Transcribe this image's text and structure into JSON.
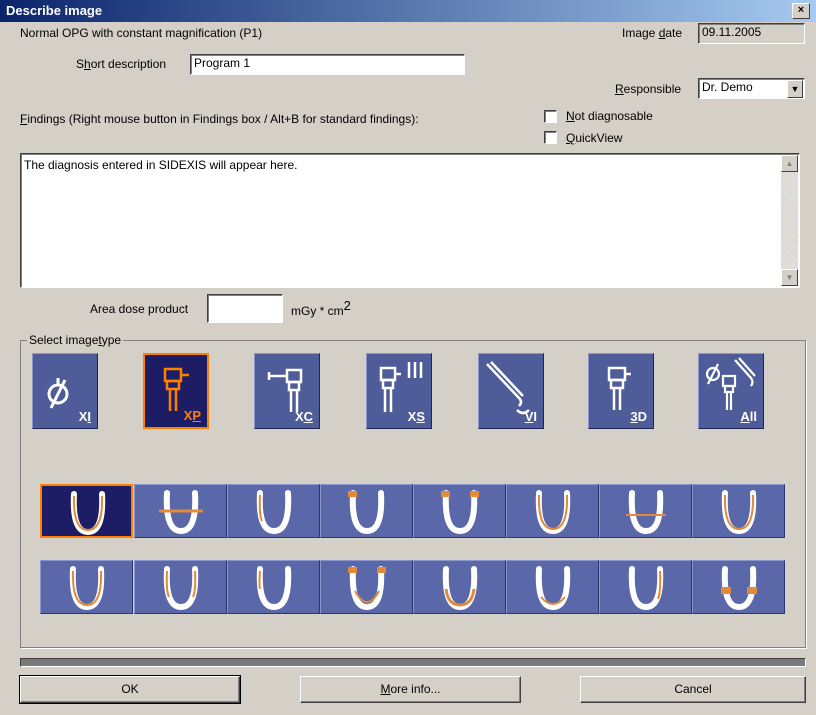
{
  "window": {
    "title": "Describe image",
    "close_glyph": "×"
  },
  "header": {
    "image_title": "Normal OPG with constant magnification (P1)",
    "image_date_label_pre": "Image ",
    "image_date_label_u": "d",
    "image_date_label_post": "ate",
    "image_date_value": "09.11.2005",
    "short_desc_label_pre": "S",
    "short_desc_label_u": "h",
    "short_desc_label_post": "ort description",
    "short_desc_value": "Program 1",
    "responsible_label_u": "R",
    "responsible_label_post": "esponsible",
    "responsible_value": "Dr. Demo",
    "findings_label_u": "F",
    "findings_label_post": "indings (Right mouse button in Findings box / Alt+B for standard findings):",
    "not_diagnosable_u": "N",
    "not_diagnosable_post": "ot diagnosable",
    "quickview_u": "Q",
    "quickview_post": "uickView"
  },
  "findings": {
    "text": "The diagnosis entered in SIDEXIS will appear here."
  },
  "dose": {
    "label": "Area dose product",
    "value": "",
    "unit": "mGy * cm",
    "unit_sup": "2"
  },
  "imagetype": {
    "legend_pre": "Select image",
    "legend_u": "t",
    "legend_post": "ype",
    "types": [
      {
        "pre": "X",
        "u": "I",
        "post": "",
        "icon": "intraoral-sensor-icon",
        "selected": false
      },
      {
        "pre": "X",
        "u": "P",
        "post": "",
        "icon": "panoramic-unit-icon",
        "selected": true
      },
      {
        "pre": "X",
        "u": "C",
        "post": "",
        "icon": "ceph-unit-icon",
        "selected": false
      },
      {
        "pre": "X",
        "u": "S",
        "post": "",
        "icon": "multi-unit-icon",
        "selected": false
      },
      {
        "pre": "",
        "u": "V",
        "post": "I",
        "icon": "intraoral-camera-icon",
        "selected": false
      },
      {
        "pre": "",
        "u": "3",
        "post": "D",
        "icon": "3d-unit-icon",
        "selected": false
      },
      {
        "pre": "",
        "u": "A",
        "post": "ll",
        "icon": "all-types-icon",
        "selected": false
      }
    ]
  },
  "programs": {
    "selected_index": 0,
    "count": 16
  },
  "buttons": {
    "ok": "OK",
    "more_u": "M",
    "more_post": "ore info...",
    "cancel": "Cancel"
  },
  "colors": {
    "accent": "#ff8000",
    "tile": "#4e5c9a",
    "tile_selected": "#1d1d66",
    "title_bar": "#0a246a"
  }
}
